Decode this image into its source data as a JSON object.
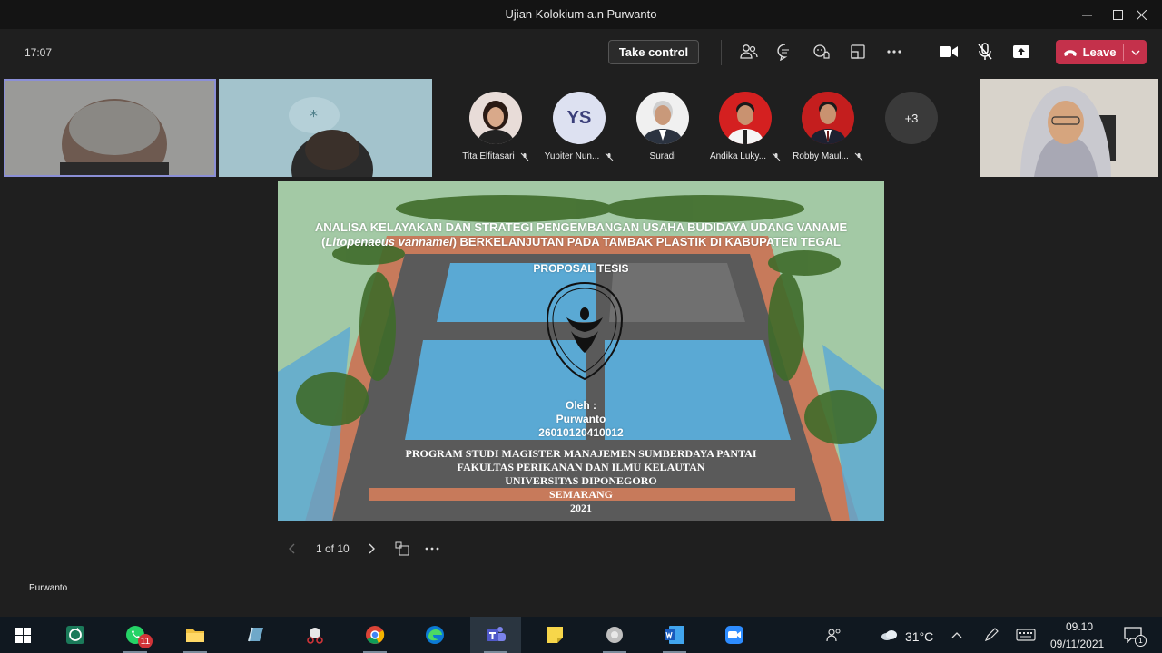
{
  "window": {
    "title": "Ujian Kolokium a.n Purwanto"
  },
  "toolbar": {
    "time": "17:07",
    "take_control": "Take control",
    "leave": "Leave"
  },
  "participants": [
    {
      "name": "Tita Elfitasari",
      "muted": true
    },
    {
      "name": "Yupiter Nun...",
      "initials": "YS",
      "muted": true
    },
    {
      "name": "Suradi",
      "muted": false
    },
    {
      "name": "Andika Luky...",
      "muted": true
    },
    {
      "name": "Robby Maul...",
      "muted": true
    },
    {
      "overflow": "+3"
    }
  ],
  "slide": {
    "title_line1": "ANALISA KELAYAKAN DAN STRATEGI PENGEMBANGAN USAHA BUDIDAYA UDANG VANAME",
    "title_line2_italic": "Litopenaeus vannamei",
    "title_line2_rest": "BERKELANJUTAN PADA TAMBAK PLASTIK DI KABUPATEN TEGAL",
    "subtitle": "PROPOSAL TESIS",
    "logo_text_top": "UNIVERSITAS DIPONEGORO",
    "logo_text_bottom": "SEMARANG",
    "by_label": "Oleh :",
    "author": "Purwanto",
    "nim": "26010120410012",
    "program": "PROGRAM STUDI MAGISTER MANAJEMEN SUMBERDAYA PANTAI",
    "faculty": "FAKULTAS PERIKANAN DAN ILMU KELAUTAN",
    "university": "UNIVERSITAS DIPONEGORO",
    "city": "SEMARANG",
    "year": "2021"
  },
  "slide_nav": {
    "page": "1 of 10"
  },
  "presenter": "Purwanto",
  "taskbar": {
    "whatsapp_badge": "11",
    "temperature": "31°C",
    "clock_time": "09.10",
    "clock_date": "09/11/2021",
    "notification_count": "1"
  }
}
